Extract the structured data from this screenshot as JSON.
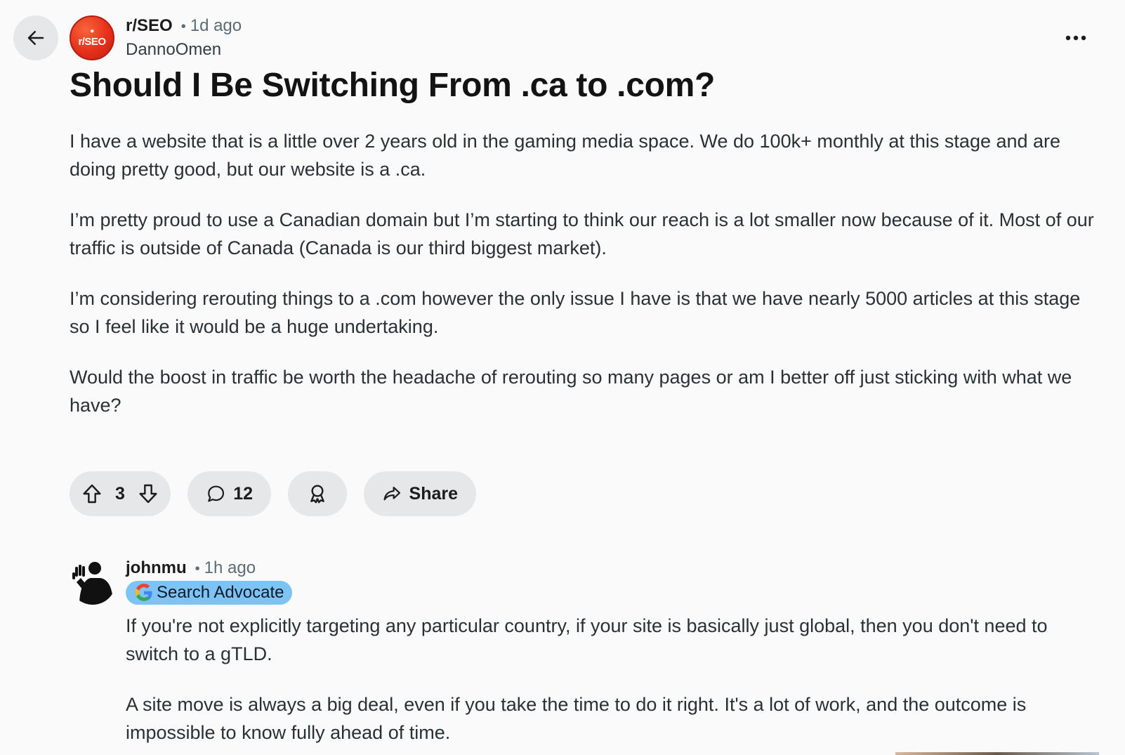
{
  "post": {
    "subreddit": "r/SEO",
    "subreddit_avatar_text": "r/SEO",
    "dot": "•",
    "time": "1d ago",
    "author": "DannoOmen",
    "title": "Should I Be Switching From .ca to .com?",
    "paragraphs": [
      "I have a website that is a little over 2 years old in the gaming media space. We do 100k+ monthly at this stage and are doing pretty good, but our website is a .ca.",
      "I’m pretty proud to use a Canadian domain but I’m starting to think our reach is a lot smaller now because of it. Most of our traffic is outside of Canada (Canada is our third biggest market).",
      "I’m considering rerouting things to a .com however the only issue I have is that we have nearly 5000 articles at this stage so I feel like it would be a huge undertaking.",
      "Would the boost in traffic be worth the headache of rerouting so many pages or am I better off just sticking with what we have?"
    ]
  },
  "actions": {
    "votes": "3",
    "comments": "12",
    "share_label": "Share"
  },
  "comment": {
    "user": "johnmu",
    "dot": "•",
    "time": "1h ago",
    "flair": "Search Advocate",
    "paragraphs": [
      "If you're not explicitly targeting any particular country, if your site is basically just global, then you don't need to switch to a gTLD.",
      "A site move is always a big deal, even if you take the time to do it right. It's a lot of work, and the outcome is impossible to know fully ahead of time."
    ]
  },
  "icons": {
    "back": "arrow-left-icon",
    "more": "more-horizontal-icon",
    "upvote": "upvote-icon",
    "downvote": "downvote-icon",
    "comment": "comment-icon",
    "award": "award-icon",
    "share": "share-icon"
  },
  "colors": {
    "subreddit_avatar": "#e6301b",
    "flair_bg": "#7dc4f5",
    "pill_bg": "#e5e7e9",
    "page_bg": "#fafafa"
  }
}
